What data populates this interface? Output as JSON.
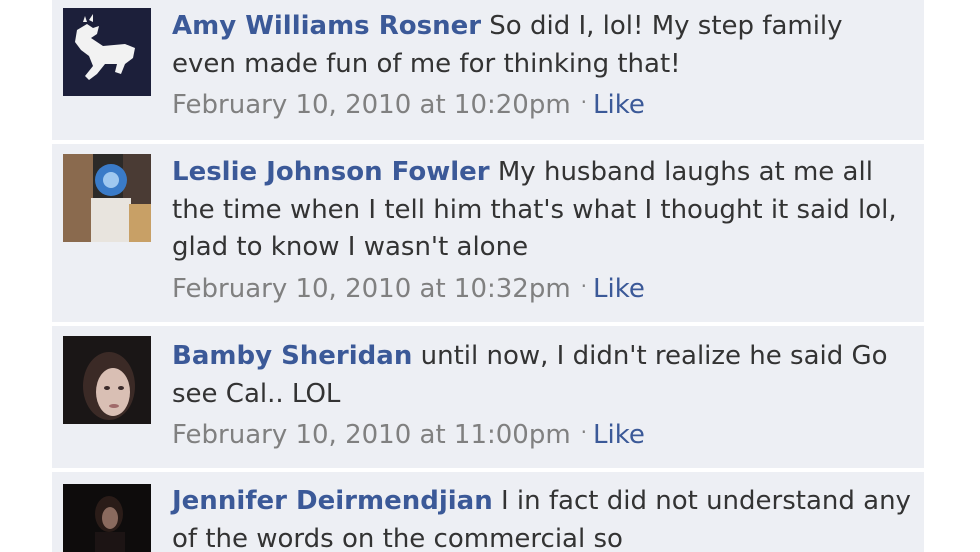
{
  "comments": [
    {
      "author": "Amy Williams Rosner",
      "text": "So did I, lol! My step family even made fun of me for thinking that!",
      "timestamp": "February 10, 2010 at 10:20pm",
      "separator": "·",
      "like_label": "Like"
    },
    {
      "author": "Leslie Johnson Fowler",
      "text": "My husband laughs at me all the time when I tell him that's what I thought it said lol, glad to know I wasn't alone",
      "timestamp": "February 10, 2010 at 10:32pm",
      "separator": "·",
      "like_label": "Like"
    },
    {
      "author": "Bamby Sheridan",
      "text": "until now, I didn't realize he said Go see Cal.. LOL",
      "timestamp": "February 10, 2010 at 11:00pm",
      "separator": "·",
      "like_label": "Like"
    },
    {
      "author": "Jennifer Deirmendjian",
      "text": "I in fact did not understand any of the words on the commercial so",
      "timestamp": "",
      "separator": "",
      "like_label": ""
    }
  ]
}
